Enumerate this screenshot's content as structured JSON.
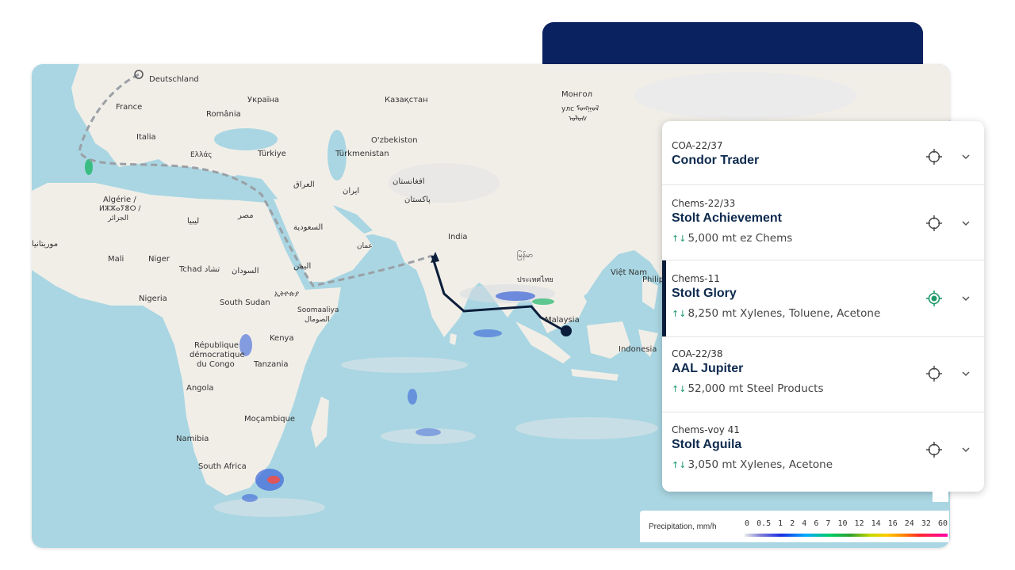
{
  "map": {
    "labels": {
      "deutschland": "Deutschland",
      "france": "France",
      "romania": "România",
      "ukraina": "Україна",
      "kazakhstan": "Казақстан",
      "mongol": "Монгол",
      "mongol2": "улс ᠮᠣᠩᠭᠣᠯ",
      "mongol3": "ᠤᠯᠤᠰ",
      "italia": "Italia",
      "ellas": "Ελλάς",
      "turkiye": "Türkiye",
      "turkmenistan": "Türkmenistan",
      "ozbekiston": "O'zbekiston",
      "iraq": "العراق",
      "iran": "ایران",
      "afghanistan": "افغانستان",
      "pakistan": "پاکستان",
      "algerie": "Algérie /",
      "algerie2": "ⵍⵣⵣⴰⵢⴻⵔ /",
      "algerie3": "الجزائر",
      "libya": "ليبيا",
      "misr": "مصر",
      "saudi": "السعودية",
      "oman": "عمان",
      "mauritania": "موريتانيا",
      "india": "India",
      "mali": "Mali",
      "niger": "Niger",
      "tchad": "Tchad تشاد",
      "sudan": "السودان",
      "yemen": "اليمن",
      "nigeria": "Nigeria",
      "south_sudan": "South Sudan",
      "ethiopia": "ኢትዮጵያ",
      "somaliland": "Soomaaliya",
      "somaliland2": "الصومال",
      "kenya": "Kenya",
      "drc": "République",
      "drc2": "démocratique",
      "drc3": "du Congo",
      "tanzania": "Tanzania",
      "angola": "Angola",
      "mocambique": "Moçambique",
      "namibia": "Namibia",
      "south_africa": "South Africa",
      "myanmar": "မြန်မာ",
      "vietnam": "Việt Nam",
      "philippines": "Philippines",
      "malaysia": "Malaysia",
      "indonesia": "Indonesia",
      "thailand": "ประเทศไทย"
    }
  },
  "voyages": [
    {
      "code": "COA-22/37",
      "name": "Condor Trader",
      "cargo": "",
      "active": false
    },
    {
      "code": "Chems-22/33",
      "name": "Stolt Achievement",
      "cargo": "5,000 mt ez Chems",
      "active": false
    },
    {
      "code": "Chems-11",
      "name": "Stolt Glory",
      "cargo": "8,250 mt Xylenes, Toluene, Acetone",
      "active": true
    },
    {
      "code": "COA-22/38",
      "name": "AAL Jupiter",
      "cargo": "52,000 mt Steel Products",
      "active": false
    },
    {
      "code": "Chems-voy 41",
      "name": "Stolt Aguila",
      "cargo": "3,050 mt Xylenes, Acetone",
      "active": false
    }
  ],
  "legend": {
    "title": "Precipitation, mm/h",
    "ticks": [
      "0",
      "0.5",
      "1",
      "2",
      "4",
      "6",
      "7",
      "10",
      "12",
      "14",
      "16",
      "24",
      "32",
      "60"
    ]
  },
  "colors": {
    "navy": "#0b2260",
    "active_target": "#1e9a6a",
    "route": "#0b1d3a"
  }
}
